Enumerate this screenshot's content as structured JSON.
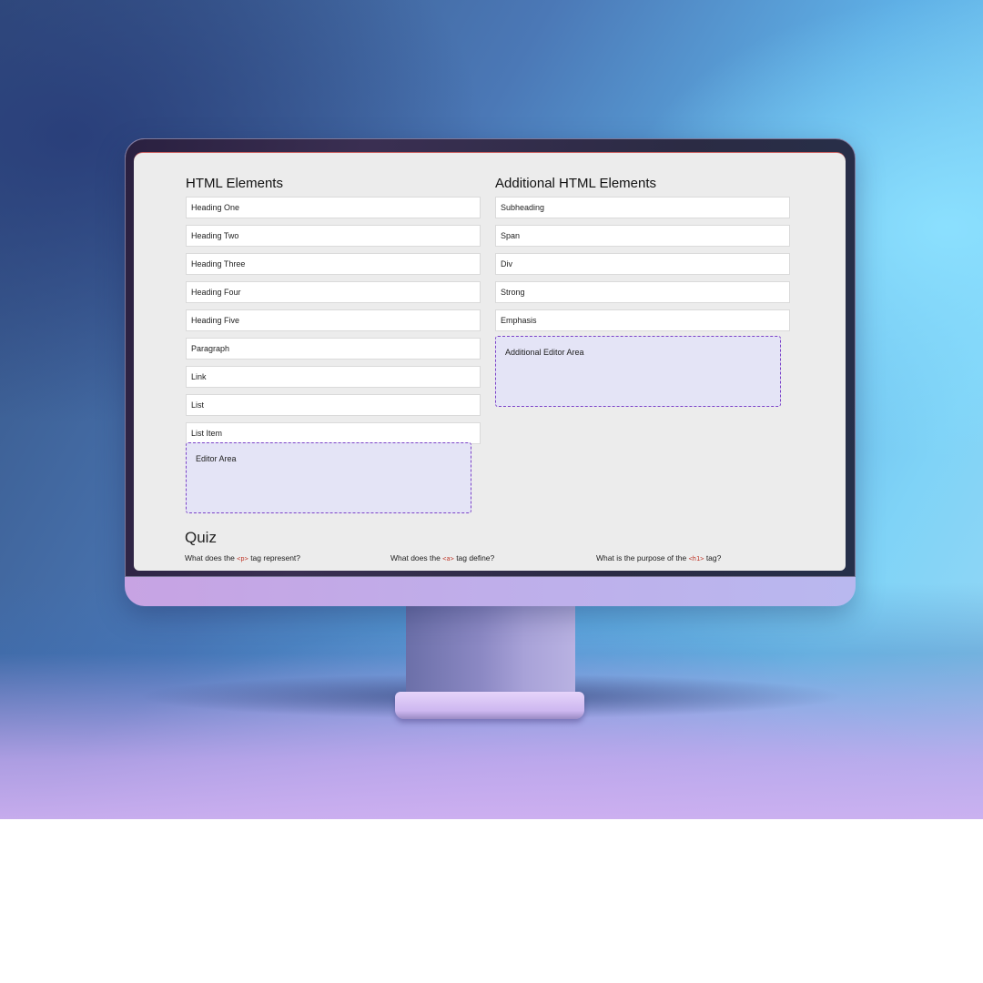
{
  "left_panel": {
    "title": "HTML Elements",
    "items": [
      "Heading One",
      "Heading Two",
      "Heading Three",
      "Heading Four",
      "Heading Five",
      "Paragraph",
      "Link",
      "List",
      "List Item"
    ],
    "editor_label": "Editor Area"
  },
  "right_panel": {
    "title": "Additional HTML Elements",
    "items": [
      "Subheading",
      "Span",
      "Div",
      "Strong",
      "Emphasis"
    ],
    "editor_label": "Additional Editor Area"
  },
  "quiz": {
    "title": "Quiz",
    "questions": [
      {
        "before": "What does the ",
        "tag": "<p>",
        "after": " tag represent?"
      },
      {
        "before": "What does the ",
        "tag": "<a>",
        "after": " tag define?"
      },
      {
        "before": "What is the purpose of the ",
        "tag": "<h1>",
        "after": " tag?"
      }
    ]
  },
  "colors": {
    "editor_border": "#7b42c8",
    "editor_fill": "#e4e4f6",
    "code_tag": "#c0392b",
    "screen_bg": "#ececec"
  }
}
